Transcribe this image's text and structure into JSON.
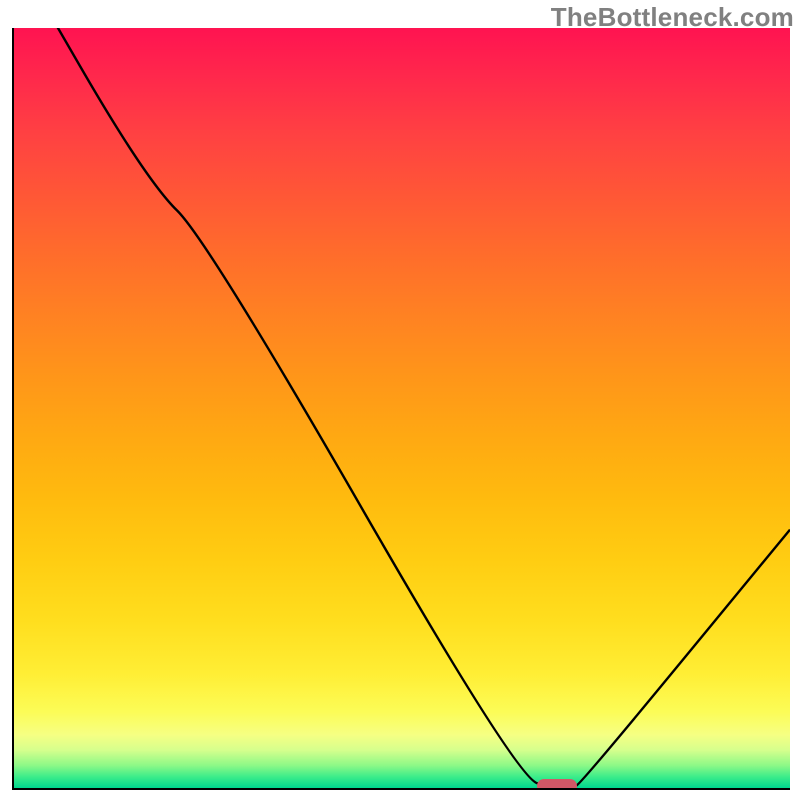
{
  "watermark": "TheBottleneck.com",
  "chart_data": {
    "type": "line",
    "title": "",
    "xlabel": "",
    "ylabel": "",
    "xlim": [
      0,
      100
    ],
    "ylim": [
      0,
      100
    ],
    "x": [
      0,
      17,
      25,
      65,
      70,
      72,
      73,
      100
    ],
    "values": [
      110,
      80,
      72,
      1,
      0.2,
      0.2,
      0.5,
      34
    ],
    "series_name": "bottleneck-curve",
    "gradient_stops": [
      {
        "pos": 0,
        "color": "#ff1351"
      },
      {
        "pos": 7,
        "color": "#ff2a4b"
      },
      {
        "pos": 14,
        "color": "#ff4142"
      },
      {
        "pos": 22,
        "color": "#ff5736"
      },
      {
        "pos": 30,
        "color": "#ff6d2b"
      },
      {
        "pos": 38,
        "color": "#ff8222"
      },
      {
        "pos": 46,
        "color": "#ff9619"
      },
      {
        "pos": 54,
        "color": "#ffa912"
      },
      {
        "pos": 62,
        "color": "#ffbb0e"
      },
      {
        "pos": 70,
        "color": "#ffcd12"
      },
      {
        "pos": 78,
        "color": "#ffde1e"
      },
      {
        "pos": 85,
        "color": "#ffee35"
      },
      {
        "pos": 90,
        "color": "#fcfc57"
      },
      {
        "pos": 93,
        "color": "#f6ff83"
      },
      {
        "pos": 95,
        "color": "#d6ff8d"
      },
      {
        "pos": 97,
        "color": "#8ef987"
      },
      {
        "pos": 98.5,
        "color": "#3ded8a"
      },
      {
        "pos": 100,
        "color": "#00d68e"
      }
    ],
    "optimum_marker": {
      "x": 70,
      "y": 0.2,
      "color": "#d15866"
    }
  }
}
